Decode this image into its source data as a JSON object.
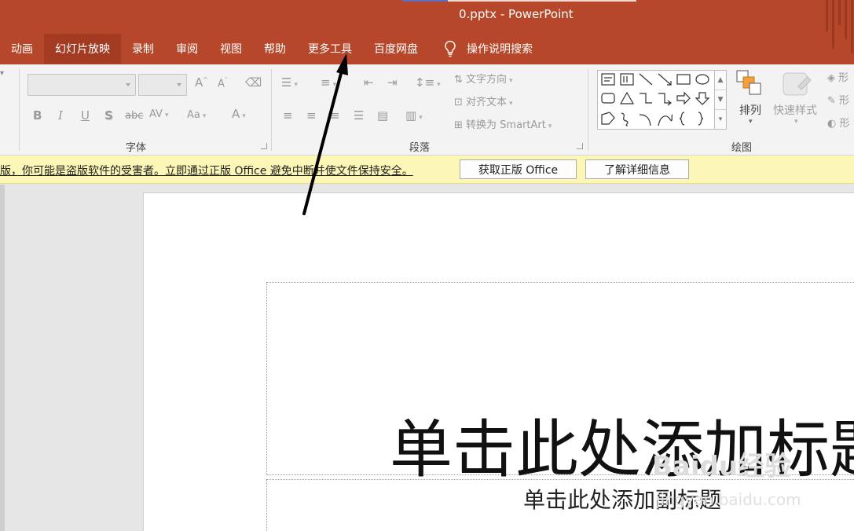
{
  "window": {
    "title": "0.pptx  -  PowerPoint"
  },
  "tabs": [
    {
      "label": "动画"
    },
    {
      "label": "幻灯片放映"
    },
    {
      "label": "录制"
    },
    {
      "label": "审阅"
    },
    {
      "label": "视图"
    },
    {
      "label": "帮助"
    },
    {
      "label": "更多工具"
    },
    {
      "label": "百度网盘"
    }
  ],
  "tell_me": {
    "label": "操作说明搜索",
    "icon": "lightbulb-icon"
  },
  "ribbon": {
    "font_group": {
      "label": "字体",
      "bold": "B",
      "italic": "I",
      "underline": "U",
      "shadow": "S",
      "strike": "abc",
      "spacing": "AV",
      "case": "Aa",
      "grow": "A",
      "shrink": "A",
      "font_color": "A"
    },
    "paragraph_group": {
      "label": "段落",
      "text_direction": "文字方向",
      "align_text": "对齐文本",
      "convert_smartart": "转换为 SmartArt"
    },
    "drawing_group": {
      "label": "绘图",
      "arrange": "排列",
      "quick_styles": "快速样式",
      "shape_fill": "形",
      "shape_outline": "形",
      "shape_effects": "形"
    }
  },
  "security_bar": {
    "message": "版，你可能是盗版软件的受害者。立即通过正版 Office 避免中断并使文件保持安全。",
    "get_genuine_button": "获取正版 Office",
    "learn_more_button": "了解详细信息"
  },
  "slide": {
    "title_placeholder": "单击此处添加标题",
    "subtitle_placeholder": "单击此处添加副标题"
  },
  "watermark": {
    "text": "Baidu经验",
    "url": "jingyan.baidu.com"
  },
  "colors": {
    "accent": "#b7472a",
    "security_bar": "#fcf7b6"
  }
}
